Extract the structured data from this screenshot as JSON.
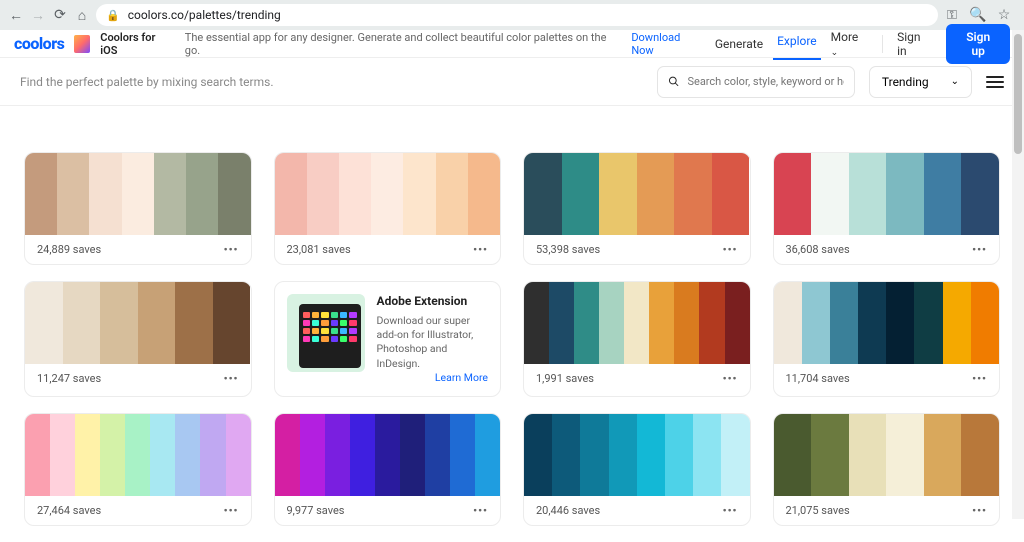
{
  "browser": {
    "url": "coolors.co/palettes/trending"
  },
  "header": {
    "logo": "coolors",
    "app_name": "Coolors for iOS",
    "app_desc": "The essential app for any designer. Generate and collect beautiful color palettes on the go.",
    "download": "Download Now",
    "nav": {
      "generate": "Generate",
      "explore": "Explore",
      "more": "More"
    },
    "signin": "Sign in",
    "signup": "Sign up"
  },
  "subbar": {
    "hint": "Find the perfect palette by mixing search terms.",
    "search_placeholder": "Search color, style, keyword or hex value",
    "sort": "Trending"
  },
  "promo": {
    "title": "Adobe Extension",
    "desc": "Download our super add-on for Illustrator, Photoshop and InDesign.",
    "cta": "Learn More"
  },
  "palettes": [
    {
      "saves": "24,889 saves",
      "colors": [
        "#c49b7d",
        "#dbbfa3",
        "#f5e0d1",
        "#fbece0",
        "#b3b9a3",
        "#97a38b",
        "#7a806b"
      ]
    },
    {
      "saves": "23,081 saves",
      "colors": [
        "#f3b7ab",
        "#f8cdc4",
        "#fde1d7",
        "#fdece2",
        "#fde5cc",
        "#f9d1a9",
        "#f5b98c"
      ]
    },
    {
      "saves": "53,398 saves",
      "colors": [
        "#2a4d5b",
        "#2e8c87",
        "#e9c66b",
        "#e49b55",
        "#e0784e",
        "#d95745"
      ]
    },
    {
      "saves": "36,608 saves",
      "colors": [
        "#d84452",
        "#f2f7f3",
        "#b8e0d8",
        "#7cb9c0",
        "#3f7da3",
        "#2b4a6f"
      ]
    },
    {
      "saves": "11,247 saves",
      "colors": [
        "#f0e8dc",
        "#e6d8c2",
        "#d6be9b",
        "#c7a176",
        "#9d7048",
        "#66452e"
      ]
    },
    {
      "type": "promo"
    },
    {
      "saves": "1,991 saves",
      "colors": [
        "#2f2f2f",
        "#1d4a66",
        "#2f8c87",
        "#a7d3c1",
        "#f2e7c6",
        "#e8a13a",
        "#d97b1f",
        "#b23a1f",
        "#7a1f1f"
      ]
    },
    {
      "saves": "11,704 saves",
      "colors": [
        "#f0e8dc",
        "#8ec7d2",
        "#3a8099",
        "#0e3a52",
        "#042033",
        "#0f3d44",
        "#f5a900",
        "#f07c00"
      ]
    },
    {
      "saves": "27,464 saves",
      "colors": [
        "#fba0b0",
        "#ffd1dc",
        "#fff2a8",
        "#d4f2a8",
        "#a8f2c6",
        "#a8e8f2",
        "#a8c8f2",
        "#c0a8f2",
        "#e0a8f2"
      ]
    },
    {
      "saves": "9,977 saves",
      "colors": [
        "#d41fa3",
        "#b31fe0",
        "#7a1fe0",
        "#3f1fe0",
        "#2a1b9e",
        "#1f1f7a",
        "#1f3fa3",
        "#1f6bd4",
        "#1f9de0"
      ]
    },
    {
      "saves": "20,446 saves",
      "colors": [
        "#0a3f5c",
        "#0d5a7a",
        "#0f7a99",
        "#1199b8",
        "#13b8d6",
        "#4dd2e8",
        "#8ce4f2",
        "#c2f0f7"
      ]
    },
    {
      "saves": "21,075 saves",
      "colors": [
        "#4a5a2f",
        "#6b7a3f",
        "#e8e0b8",
        "#f5efd8",
        "#d9a85c",
        "#b8783a"
      ]
    }
  ]
}
